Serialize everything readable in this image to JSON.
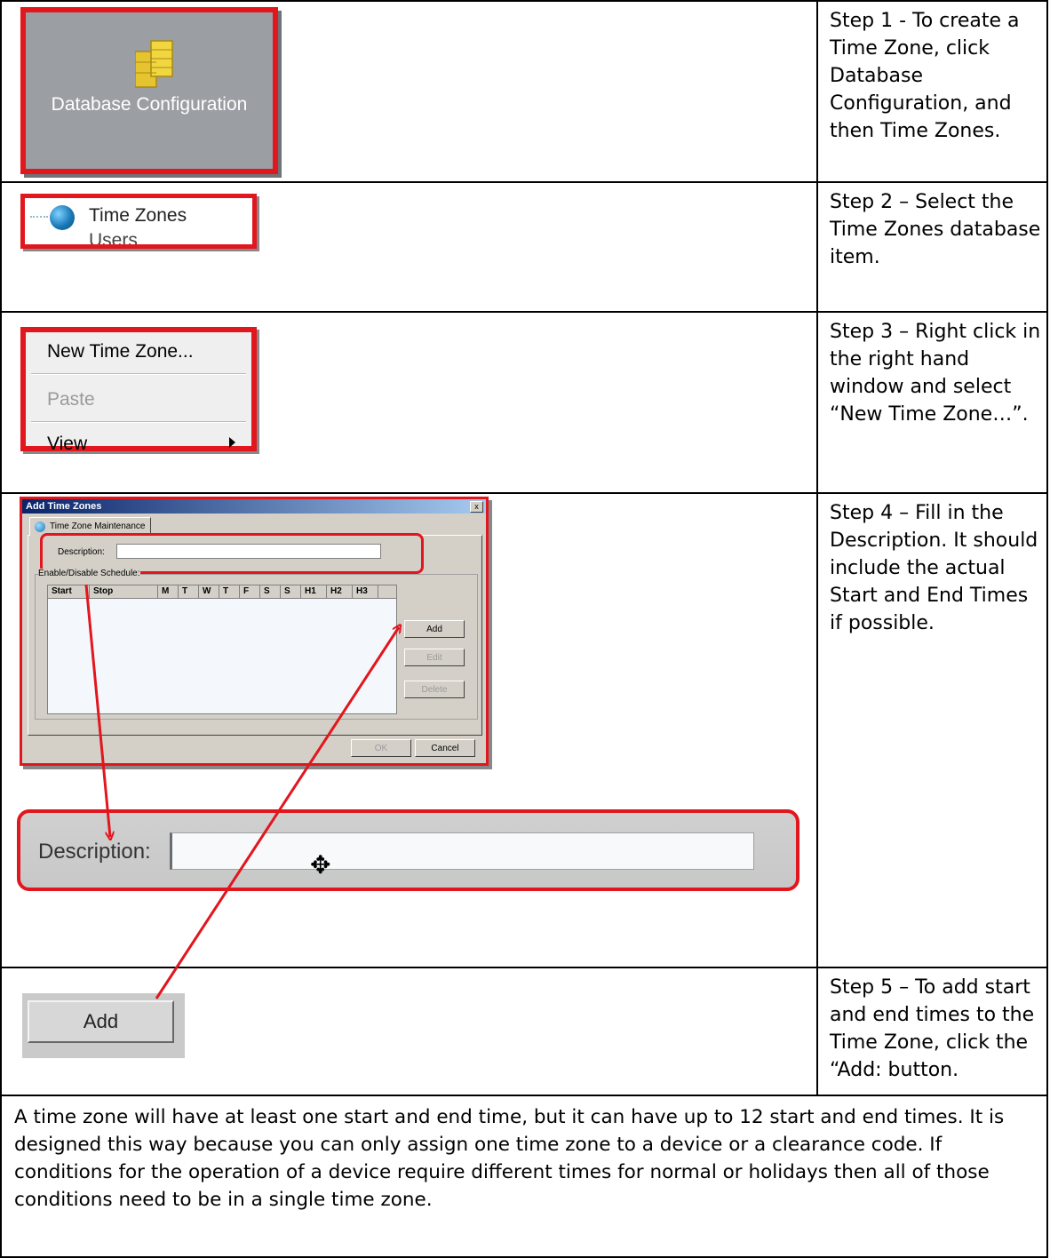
{
  "steps": [
    {
      "text": "Step 1 - To create a Time Zone, click Database Configuration, and then Time Zones."
    },
    {
      "text": "Step 2 – Select the Time Zones database item."
    },
    {
      "text": "Step 3 – Right click in the right hand window and select “New Time Zone…”."
    },
    {
      "text": "Step 4 – Fill in the Description. It should include the actual Start and End Times if possible."
    },
    {
      "text": "Step 5 – To add start and end times to the Time Zone, click the “Add: button."
    }
  ],
  "db_config": {
    "label": "Database Configuration",
    "icon": "database-icon"
  },
  "tree": {
    "time_zones": "Time Zones",
    "users": "Users",
    "icon": "globe-icon"
  },
  "context_menu": {
    "items": [
      "New Time Zone...",
      "Paste",
      "View"
    ],
    "disabled": [
      "Paste"
    ]
  },
  "dialog": {
    "title": "Add Time Zones",
    "close": "x",
    "tab": "Time Zone Maintenance",
    "description_label": "Description:",
    "group_label": "Enable/Disable Schedule:",
    "columns": [
      "Start",
      "Stop",
      "M",
      "T",
      "W",
      "T",
      "F",
      "S",
      "S",
      "H1",
      "H2",
      "H3"
    ],
    "buttons": {
      "add": "Add",
      "edit": "Edit",
      "delete": "Delete",
      "ok": "OK",
      "cancel": "Cancel"
    }
  },
  "zoom": {
    "description_label": "Description:"
  },
  "add_button": {
    "label": "Add"
  },
  "note": "A time zone will have at least one start and end time, but it can have up to 12 start and end times. It is designed this way because you can only assign one time zone to a device or a clearance code. If conditions for the operation of a device require different times for normal or holidays then all of those conditions need to be in a single time zone.",
  "colors": {
    "highlight": "#e2161d",
    "panel_gray": "#9b9ea3",
    "dialog_gray": "#d4d0c8"
  }
}
